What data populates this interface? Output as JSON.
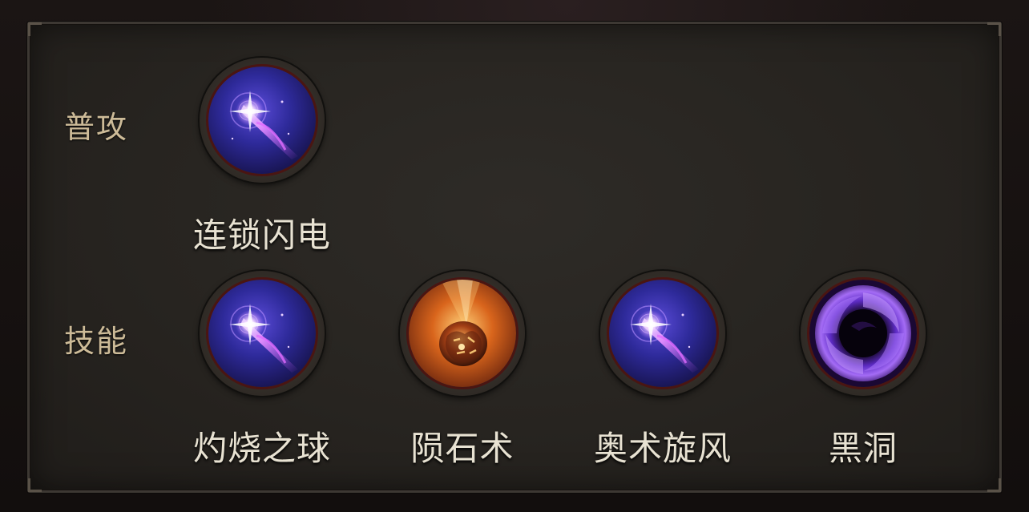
{
  "rows": {
    "normal_attack": {
      "label": "普攻",
      "skills": [
        {
          "name": "连锁闪电",
          "icon": "chain-lightning-icon"
        }
      ]
    },
    "skills": {
      "label": "技能",
      "skills": [
        {
          "name": "灼烧之球",
          "icon": "chain-lightning-icon"
        },
        {
          "name": "陨石术",
          "icon": "meteor-icon"
        },
        {
          "name": "奥术旋风",
          "icon": "chain-lightning-icon"
        },
        {
          "name": "黑洞",
          "icon": "black-hole-icon"
        }
      ]
    }
  },
  "colors": {
    "label": "#cdbb98",
    "skill_name": "#e8e2d2",
    "panel_bg": "#2b2824",
    "frame_ring": "#4a1512",
    "arcane": "#7b3cf0",
    "fire": "#e0761f"
  }
}
